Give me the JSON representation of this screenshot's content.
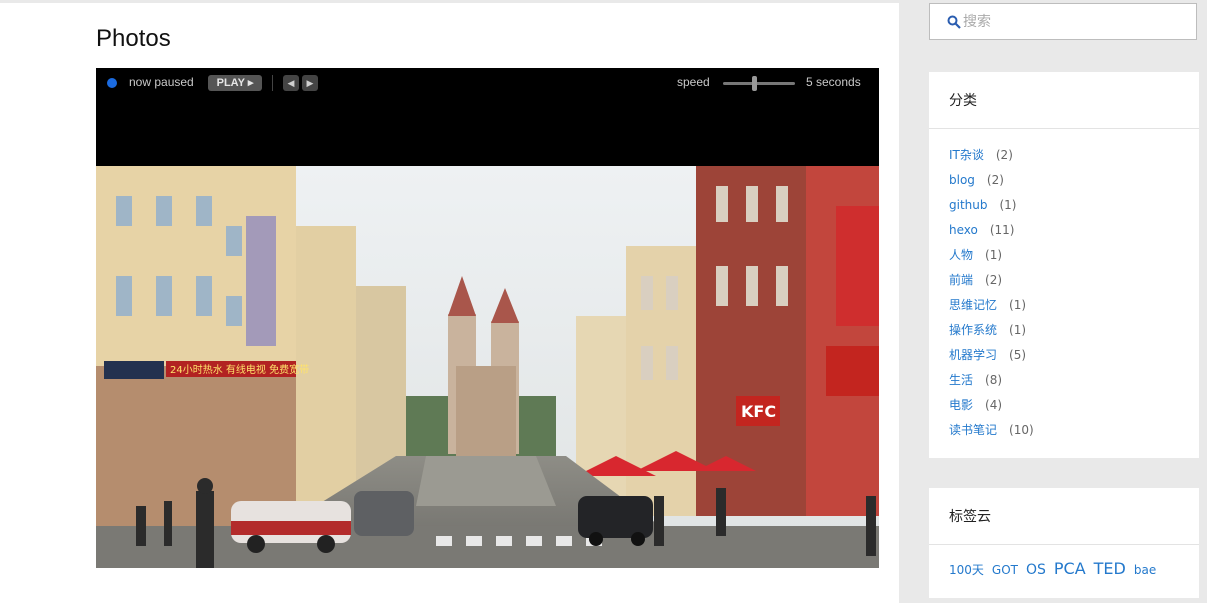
{
  "page": {
    "title": "Photos"
  },
  "slideshow": {
    "status_text": "now paused",
    "play_label": "PLAY",
    "prev_icon": "chevron-left-icon",
    "next_icon": "chevron-right-icon",
    "speed_label": "speed",
    "speed_value": "5 seconds",
    "speed_slider_fraction": 0.43,
    "photo_description_icon": "photo"
  },
  "search": {
    "placeholder": "搜索",
    "icon": "search-icon"
  },
  "categories": {
    "title": "分类",
    "items": [
      {
        "label": "IT杂谈",
        "count": "(2)"
      },
      {
        "label": "blog",
        "count": "(2)"
      },
      {
        "label": "github",
        "count": "(1)"
      },
      {
        "label": "hexo",
        "count": "(11)"
      },
      {
        "label": "人物",
        "count": "(1)"
      },
      {
        "label": "前端",
        "count": "(2)"
      },
      {
        "label": "思维记忆",
        "count": "(1)"
      },
      {
        "label": "操作系统",
        "count": "(1)"
      },
      {
        "label": "机器学习",
        "count": "(5)"
      },
      {
        "label": "生活",
        "count": "(8)"
      },
      {
        "label": "电影",
        "count": "(4)"
      },
      {
        "label": "读书笔记",
        "count": "(10)"
      }
    ]
  },
  "tag_cloud": {
    "title": "标签云",
    "tags": [
      {
        "label": "100天",
        "size": "small"
      },
      {
        "label": "GOT",
        "size": "small"
      },
      {
        "label": "OS",
        "size": "medium"
      },
      {
        "label": "PCA",
        "size": "large"
      },
      {
        "label": "TED",
        "size": "large"
      },
      {
        "label": "bae",
        "size": "small"
      }
    ]
  },
  "colors": {
    "link": "#2479cc",
    "status_dot": "#1b6be0",
    "page_bg": "#e9e9e9"
  }
}
